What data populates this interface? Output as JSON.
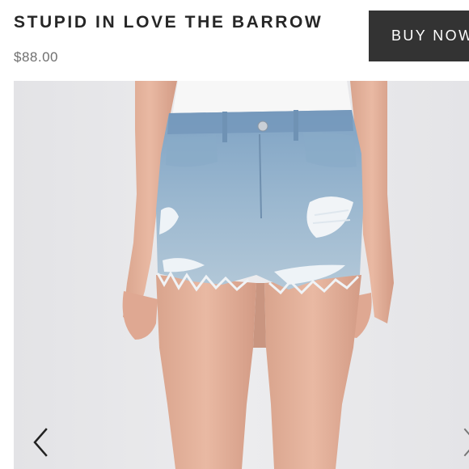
{
  "product": {
    "title": "STUPID IN LOVE THE BARROW",
    "price": "$88.00"
  },
  "actions": {
    "buy_label": "BUY NOW"
  },
  "gallery": {
    "image_description_icon": "denim-shorts-photo",
    "prev_icon": "chevron-left-icon",
    "next_icon": "chevron-right-icon"
  },
  "colors": {
    "title": "#262626",
    "price": "#6f6f6f",
    "button_bg": "#333333",
    "button_text": "#ffffff",
    "photo_bg": "#e6e6e8",
    "denim": "#8fb0cc"
  }
}
